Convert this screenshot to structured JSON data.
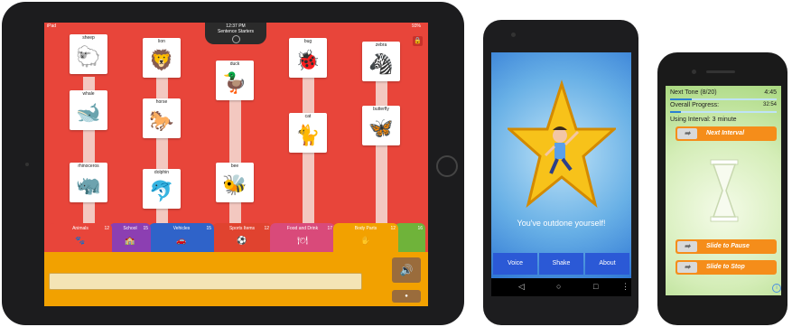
{
  "ipad": {
    "status": {
      "carrier": "iPad",
      "time": "12:37 PM",
      "battery": "93%"
    },
    "title": "Sentence Starters",
    "cards": [
      {
        "label": "sheep",
        "icon": "sheep-icon",
        "glyph": "🐑"
      },
      {
        "label": "lion",
        "icon": "lion-icon",
        "glyph": "🦁"
      },
      {
        "label": "duck",
        "icon": "duck-icon",
        "glyph": "🦆"
      },
      {
        "label": "bug",
        "icon": "bug-icon",
        "glyph": "🐞"
      },
      {
        "label": "zebra",
        "icon": "zebra-icon",
        "glyph": "🦓"
      },
      {
        "label": "whale",
        "icon": "whale-icon",
        "glyph": "🐋"
      },
      {
        "label": "horse",
        "icon": "horse-icon",
        "glyph": "🐎"
      },
      {
        "label": "cat",
        "icon": "cat-icon",
        "glyph": "🐈"
      },
      {
        "label": "butterfly",
        "icon": "butterfly-icon",
        "glyph": "🦋"
      },
      {
        "label": "rhinoceros",
        "icon": "rhinoceros-icon",
        "glyph": "🦏"
      },
      {
        "label": "dolphin",
        "icon": "dolphin-icon",
        "glyph": "🐬"
      },
      {
        "label": "bee",
        "icon": "bee-icon",
        "glyph": "🐝"
      }
    ],
    "tabs": [
      {
        "name": "Animals",
        "count": "12",
        "color": "#e8453a",
        "icon": "paw-icon",
        "glyph": "🐾"
      },
      {
        "name": "School",
        "count": "15",
        "color": "#8c3fb2",
        "icon": "school-icon",
        "glyph": "🏫"
      },
      {
        "name": "Vehicles",
        "count": "15",
        "color": "#2f63c9",
        "icon": "car-icon",
        "glyph": "🚗"
      },
      {
        "name": "Sports Items",
        "count": "12",
        "color": "#e0432f",
        "icon": "ball-icon",
        "glyph": "⚽"
      },
      {
        "name": "Food and Drink",
        "count": "17",
        "color": "#d94a7a",
        "icon": "food-icon",
        "glyph": "🍽"
      },
      {
        "name": "Body Parts",
        "count": "12",
        "color": "#f2a100",
        "icon": "hand-icon",
        "glyph": "✋"
      },
      {
        "name": "",
        "count": "16",
        "color": "#6fb33a",
        "icon": "",
        "glyph": ""
      }
    ],
    "speak_glyph": "🔊",
    "small_btn_glyph": "●"
  },
  "android": {
    "message": "You've outdone yourself!",
    "buttons": [
      "Voice",
      "Shake",
      "About"
    ],
    "nav": [
      "◁",
      "○",
      "□",
      "⋮"
    ]
  },
  "iphone": {
    "next_tone_label": "Next Tone (8/20)",
    "next_tone_time": "4:45",
    "overall_label": "Overall Progress:",
    "overall_time": "32:54",
    "interval_text": "Using Interval: 3 minute",
    "buttons": [
      "Next Interval",
      "Slide to Pause",
      "Slide to Stop"
    ],
    "arrow_glyph": "➡",
    "info_glyph": "i",
    "next_tone_progress": 0.2,
    "overall_progress": 0.1
  }
}
